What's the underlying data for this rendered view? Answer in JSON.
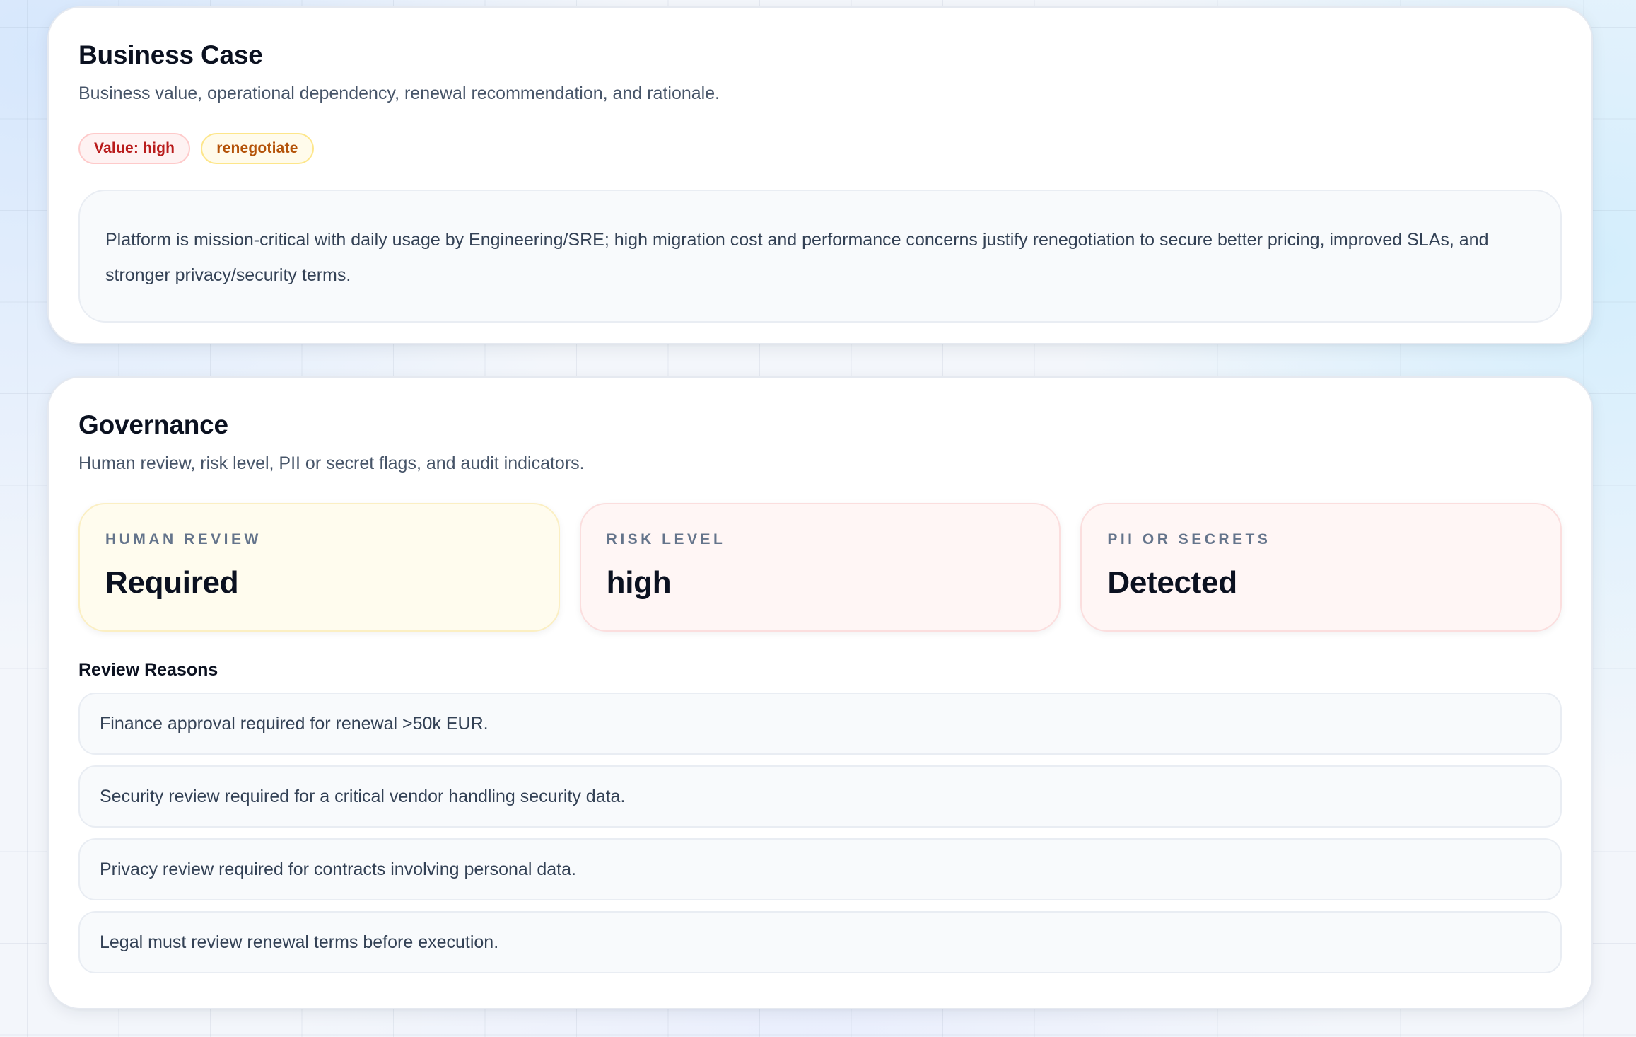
{
  "business_case": {
    "title": "Business Case",
    "subtitle": "Business value, operational dependency, renewal recommendation, and rationale.",
    "badges": {
      "value": "Value: high",
      "recommendation": "renegotiate"
    },
    "rationale": "Platform is mission-critical with daily usage by Engineering/SRE; high migration cost and performance concerns justify renegotiation to secure better pricing, improved SLAs, and stronger privacy/security terms."
  },
  "governance": {
    "title": "Governance",
    "subtitle": "Human review, risk level, PII or secret flags, and audit indicators.",
    "stats": [
      {
        "label": "HUMAN REVIEW",
        "value": "Required"
      },
      {
        "label": "RISK LEVEL",
        "value": "high"
      },
      {
        "label": "PII OR SECRETS",
        "value": "Detected"
      }
    ],
    "reasons_title": "Review Reasons",
    "reasons": [
      "Finance approval required for renewal >50k EUR.",
      "Security review required for a critical vendor handling security data.",
      "Privacy review required for contracts involving personal data.",
      "Legal must review renewal terms before execution."
    ]
  },
  "colors": {
    "value_badge_text": "#b91c1c",
    "recommendation_badge_text": "#b45309",
    "review_card_bg": "#fffcee",
    "risk_card_bg": "#fff6f5"
  }
}
